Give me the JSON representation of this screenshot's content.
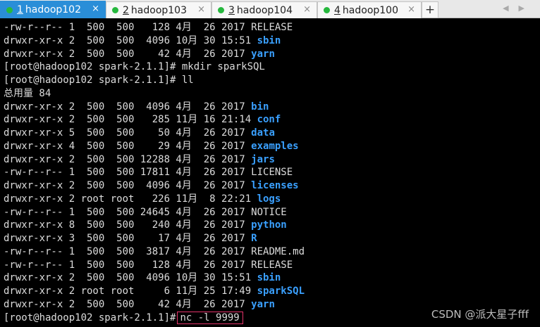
{
  "tabs": [
    {
      "num": "1",
      "label": "hadoop102",
      "active": true
    },
    {
      "num": "2",
      "label": "hadoop103",
      "active": false
    },
    {
      "num": "3",
      "label": "hadoop104",
      "active": false
    },
    {
      "num": "4",
      "label": "hadoop100",
      "active": false
    }
  ],
  "tab_close_glyph": "×",
  "new_tab_glyph": "+",
  "colors": {
    "active_tab": "#2a8ed8",
    "status_dot": "#26b83e",
    "dir_name": "#3aa0ff",
    "highlight_box": "#e5336a"
  },
  "terminal_lines": [
    {
      "text": "-rw-r--r-- 1  500  500   128 4月  26 2017 ",
      "name": "RELEASE",
      "kind": "file"
    },
    {
      "text": "drwxr-xr-x 2  500  500  4096 10月 30 15:51 ",
      "name": "sbin",
      "kind": "dir"
    },
    {
      "text": "drwxr-xr-x 2  500  500    42 4月  26 2017 ",
      "name": "yarn",
      "kind": "dir"
    },
    {
      "text": "[root@hadoop102 spark-2.1.1]# mkdir sparkSQL",
      "name": "",
      "kind": "text"
    },
    {
      "text": "[root@hadoop102 spark-2.1.1]# ll",
      "name": "",
      "kind": "text"
    },
    {
      "text": "总用量 84",
      "name": "",
      "kind": "text"
    },
    {
      "text": "drwxr-xr-x 2  500  500  4096 4月  26 2017 ",
      "name": "bin",
      "kind": "dir"
    },
    {
      "text": "drwxr-xr-x 2  500  500   285 11月 16 21:14 ",
      "name": "conf",
      "kind": "dir"
    },
    {
      "text": "drwxr-xr-x 5  500  500    50 4月  26 2017 ",
      "name": "data",
      "kind": "dir"
    },
    {
      "text": "drwxr-xr-x 4  500  500    29 4月  26 2017 ",
      "name": "examples",
      "kind": "dir"
    },
    {
      "text": "drwxr-xr-x 2  500  500 12288 4月  26 2017 ",
      "name": "jars",
      "kind": "dir"
    },
    {
      "text": "-rw-r--r-- 1  500  500 17811 4月  26 2017 ",
      "name": "LICENSE",
      "kind": "file"
    },
    {
      "text": "drwxr-xr-x 2  500  500  4096 4月  26 2017 ",
      "name": "licenses",
      "kind": "dir"
    },
    {
      "text": "drwxr-xr-x 2 root root   226 11月  8 22:21 ",
      "name": "logs",
      "kind": "dir"
    },
    {
      "text": "-rw-r--r-- 1  500  500 24645 4月  26 2017 ",
      "name": "NOTICE",
      "kind": "file"
    },
    {
      "text": "drwxr-xr-x 8  500  500   240 4月  26 2017 ",
      "name": "python",
      "kind": "dir"
    },
    {
      "text": "drwxr-xr-x 3  500  500    17 4月  26 2017 ",
      "name": "R",
      "kind": "dir"
    },
    {
      "text": "-rw-r--r-- 1  500  500  3817 4月  26 2017 ",
      "name": "README.md",
      "kind": "file"
    },
    {
      "text": "-rw-r--r-- 1  500  500   128 4月  26 2017 ",
      "name": "RELEASE",
      "kind": "file"
    },
    {
      "text": "drwxr-xr-x 2  500  500  4096 10月 30 15:51 ",
      "name": "sbin",
      "kind": "dir"
    },
    {
      "text": "drwxr-xr-x 2 root root     6 11月 25 17:49 ",
      "name": "sparkSQL",
      "kind": "dir"
    },
    {
      "text": "drwxr-xr-x 2  500  500    42 4月  26 2017 ",
      "name": "yarn",
      "kind": "dir"
    }
  ],
  "prompt": {
    "text": "[root@hadoop102 spark-2.1.1]#",
    "command": "nc -l 9999"
  },
  "watermark": "CSDN @派大星子fff"
}
